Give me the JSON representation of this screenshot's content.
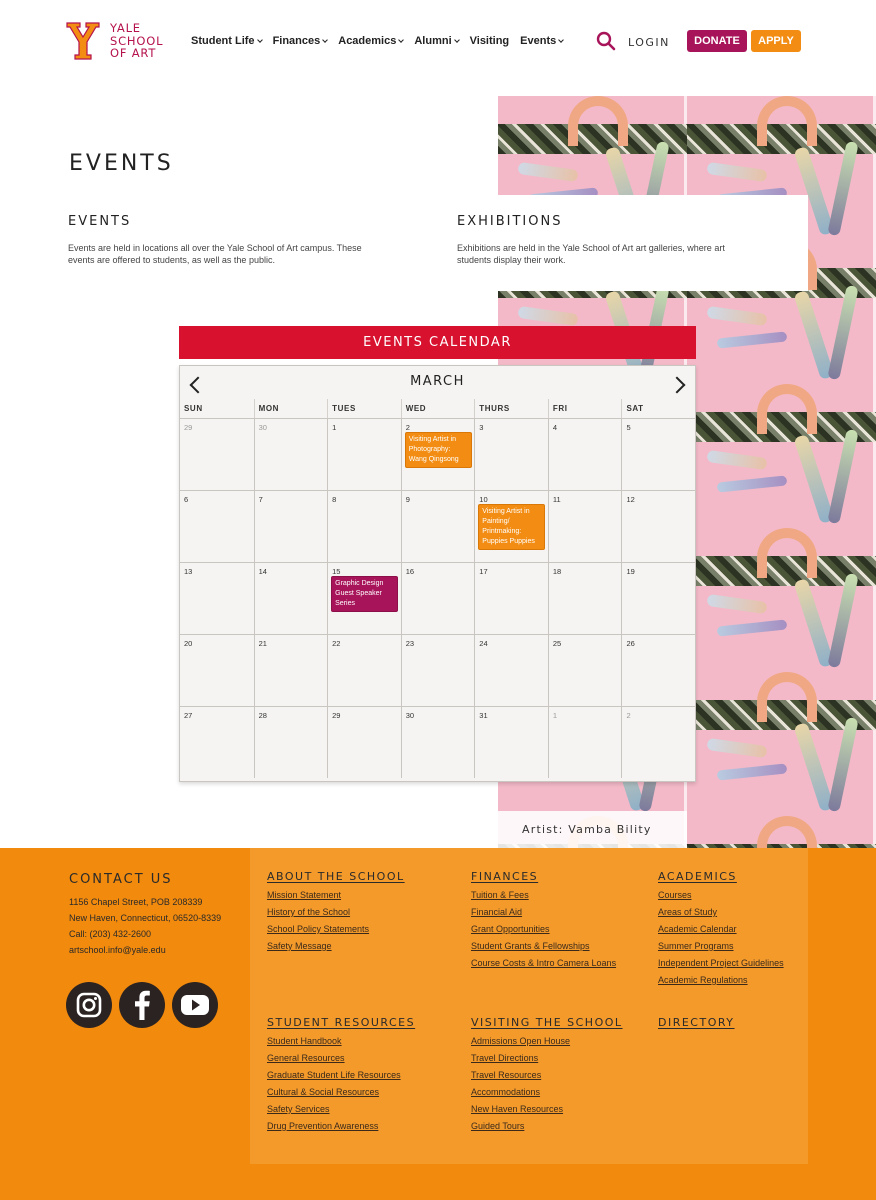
{
  "header": {
    "logo_lines": [
      "YALE",
      "SCHOOL",
      "OF ART"
    ],
    "nav": [
      {
        "label": "Student Life",
        "dropdown": true
      },
      {
        "label": "Finances",
        "dropdown": true
      },
      {
        "label": "Academics",
        "dropdown": true
      },
      {
        "label": "Alumni",
        "dropdown": true
      },
      {
        "label": "Visiting",
        "dropdown": false
      },
      {
        "label": "Events",
        "dropdown": true
      }
    ],
    "login": "LOGIN",
    "donate": "DONATE",
    "apply": "APPLY"
  },
  "colors": {
    "brand_magenta": "#a8145a",
    "brand_orange": "#f28c12",
    "banner_red": "#d8112e",
    "footer_orange": "#f28a0d"
  },
  "page_title": "EVENTS",
  "events_section": {
    "heading": "EVENTS",
    "text": "Events are held in locations all over the Yale School of Art campus. These events are offered to students, as well as the public."
  },
  "exhibitions_section": {
    "heading": "EXHIBITIONS",
    "text": "Exhibitions are held in the Yale School of Art art galleries, where art students display their work."
  },
  "artwork": {
    "caption": "Artist: Vamba Bility"
  },
  "calendar": {
    "banner": "EVENTS CALENDAR",
    "month": "MARCH",
    "weekdays": [
      "SUN",
      "MON",
      "TUES",
      "WED",
      "THURS",
      "FRI",
      "SAT"
    ],
    "weeks": [
      [
        {
          "d": "29",
          "muted": true
        },
        {
          "d": "30",
          "muted": true
        },
        {
          "d": "1"
        },
        {
          "d": "2",
          "event": {
            "title": "Visiting Artist in Photography: Wang Qingsong",
            "color": "orange"
          }
        },
        {
          "d": "3"
        },
        {
          "d": "4"
        },
        {
          "d": "5"
        }
      ],
      [
        {
          "d": "6"
        },
        {
          "d": "7"
        },
        {
          "d": "8"
        },
        {
          "d": "9"
        },
        {
          "d": "10",
          "event": {
            "title": "Visiting Artist in Painting/ Printmaking: Puppies Puppies",
            "color": "orange"
          }
        },
        {
          "d": "11"
        },
        {
          "d": "12"
        }
      ],
      [
        {
          "d": "13"
        },
        {
          "d": "14"
        },
        {
          "d": "15",
          "event": {
            "title": "Graphic Design Guest Speaker Series",
            "color": "magenta"
          }
        },
        {
          "d": "16"
        },
        {
          "d": "17"
        },
        {
          "d": "18"
        },
        {
          "d": "19"
        }
      ],
      [
        {
          "d": "20"
        },
        {
          "d": "21"
        },
        {
          "d": "22"
        },
        {
          "d": "23"
        },
        {
          "d": "24"
        },
        {
          "d": "25"
        },
        {
          "d": "26"
        }
      ],
      [
        {
          "d": "27"
        },
        {
          "d": "28"
        },
        {
          "d": "29"
        },
        {
          "d": "30"
        },
        {
          "d": "31"
        },
        {
          "d": "1",
          "muted": true
        },
        {
          "d": "2",
          "muted": true
        }
      ]
    ]
  },
  "footer": {
    "contact": {
      "heading": "CONTACT US",
      "address1": "1156 Chapel Street, POB 208339",
      "address2": "New Haven, Connecticut, 06520-8339",
      "phone": "Call: (203) 432-2600",
      "email": "artschool.info@yale.edu"
    },
    "social_icons": [
      "instagram-icon",
      "facebook-icon",
      "youtube-icon"
    ],
    "columns": [
      {
        "heading": "ABOUT THE SCHOOL",
        "links": [
          "Mission Statement",
          "History of the School",
          "School Policy Statements",
          "Safety Message"
        ]
      },
      {
        "heading": "FINANCES",
        "links": [
          "Tuition & Fees",
          "Financial Aid",
          "Grant Opportunities",
          "Student Grants & Fellowships",
          "Course Costs & Intro Camera Loans"
        ]
      },
      {
        "heading": "ACADEMICS",
        "links": [
          "Courses",
          "Areas of Study",
          "Academic Calendar",
          "Summer Programs",
          "Independent Project Guidelines",
          "Academic Regulations"
        ]
      },
      {
        "heading": "STUDENT RESOURCES",
        "links": [
          "Student Handbook",
          "General Resources",
          "Graduate Student Life Resources",
          "Cultural & Social Resources",
          "Safety Services",
          "Drug Prevention Awareness"
        ]
      },
      {
        "heading": "VISITING THE SCHOOL",
        "links": [
          "Admissions Open House",
          "Travel Directions",
          "Travel Resources",
          "Accommodations",
          "New Haven Resources",
          "Guided Tours"
        ]
      },
      {
        "heading": "DIRECTORY",
        "links": []
      }
    ]
  }
}
